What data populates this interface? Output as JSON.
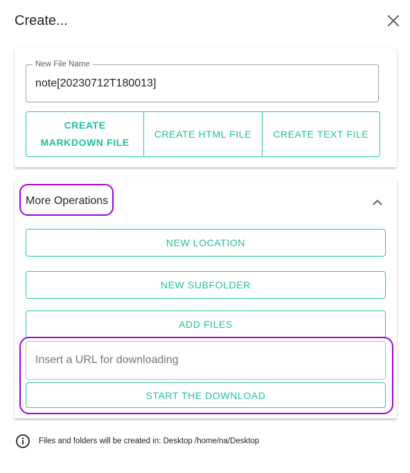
{
  "dialog": {
    "title": "Create..."
  },
  "file": {
    "label": "New File Name",
    "value": "note[20230712T180013]"
  },
  "create_buttons": {
    "markdown_line1": "CREATE",
    "markdown_line2": "MARKDOWN FILE",
    "html": "CREATE HTML FILE",
    "text": "CREATE TEXT FILE"
  },
  "more": {
    "title": "More Operations",
    "new_location": "NEW LOCATION",
    "new_subfolder": "NEW SUBFOLDER",
    "add_files": "ADD FILES",
    "url_placeholder": "Insert a URL for downloading",
    "start_download": "START THE DOWNLOAD"
  },
  "footer": {
    "info": "Files and folders will be created in: Desktop /home/na/Desktop"
  },
  "icons": {
    "close": "close-icon",
    "chevron": "chevron-up-icon",
    "info": "info-icon"
  },
  "colors": {
    "accent": "#1fbf9c",
    "highlight": "#a100d8"
  }
}
